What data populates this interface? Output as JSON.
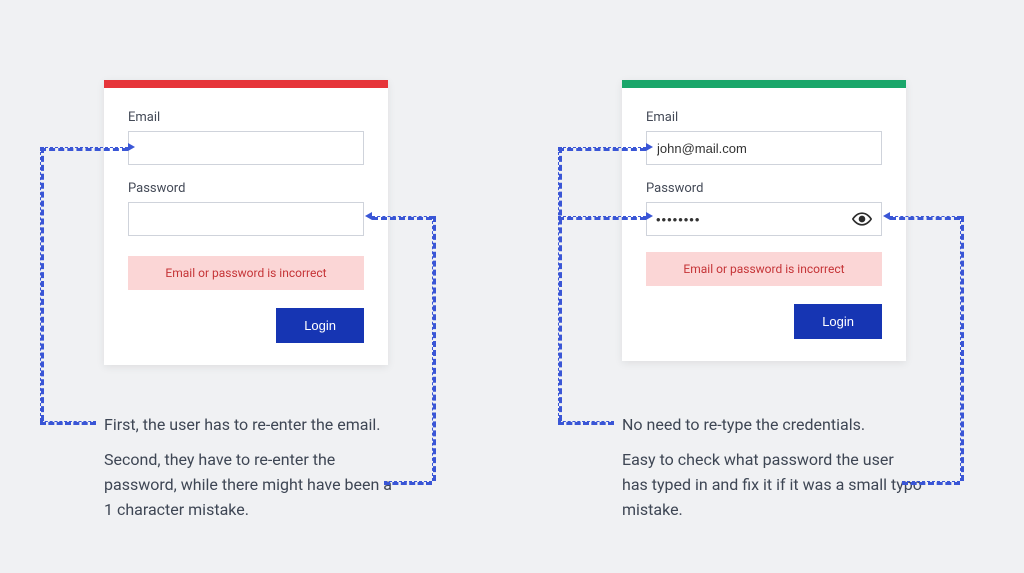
{
  "left": {
    "email_label": "Email",
    "email_value": "",
    "password_label": "Password",
    "password_value": "",
    "error_text": "Email or password is incorrect",
    "login_label": "Login",
    "caption1": "First, the user has to re-enter the email.",
    "caption2": "Second, they have to re-enter the password, while there might have been a 1 character mistake."
  },
  "right": {
    "email_label": "Email",
    "email_value": "john@mail.com",
    "password_label": "Password",
    "password_masked": "••••••••",
    "error_text": "Email or password is incorrect",
    "login_label": "Login",
    "caption1": "No need to re-type the credentials.",
    "caption2": "Easy to check what password the user has typed in and fix it if it was a small typo mistake."
  }
}
